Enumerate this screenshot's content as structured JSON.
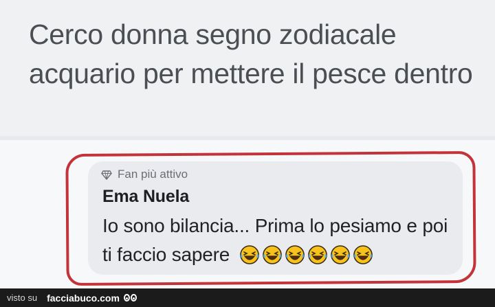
{
  "post": {
    "text": "Cerco donna segno zodiacale acquario per mettere il pesce dentro"
  },
  "comment": {
    "badge": "Fan più attivo",
    "badge_icon": "diamond-icon",
    "author": "Ema Nuela",
    "text": "Io sono bilancia... Prima lo pesiamo e poi ti faccio sapere",
    "emoji": "laughing-tears-icon",
    "emoji_count": 6
  },
  "footer": {
    "prefix": "visto su",
    "brand": "facciabuco.com"
  },
  "colors": {
    "highlight_outline": "#c2333a",
    "bubble_bg": "#e9ebee",
    "emoji_face": "#f7c21c"
  }
}
